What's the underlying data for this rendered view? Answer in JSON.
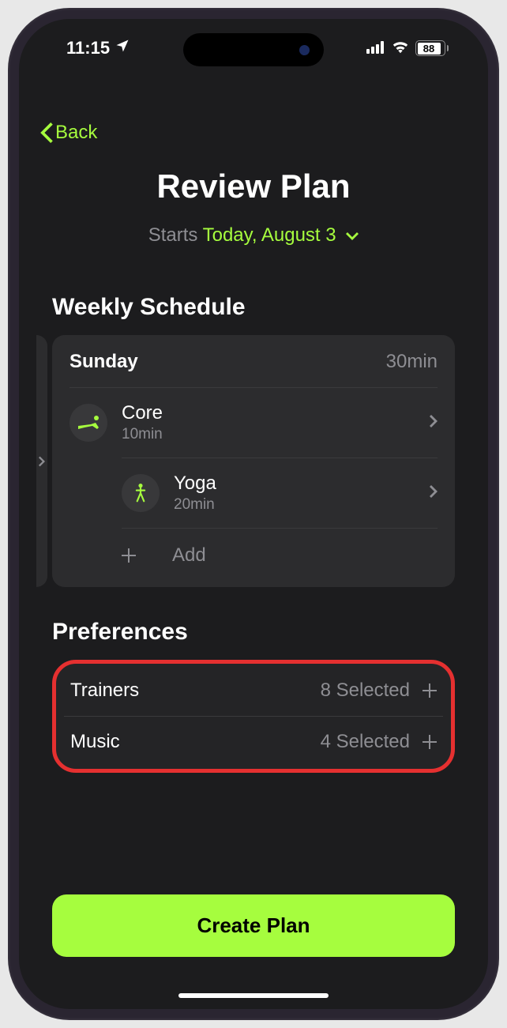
{
  "statusBar": {
    "time": "11:15",
    "battery": "88"
  },
  "nav": {
    "backLabel": "Back"
  },
  "header": {
    "title": "Review Plan",
    "startsPrefix": "Starts ",
    "startsDate": "Today, August 3"
  },
  "schedule": {
    "heading": "Weekly Schedule",
    "day": {
      "name": "Sunday",
      "totalDuration": "30min",
      "workouts": [
        {
          "name": "Core",
          "duration": "10min",
          "icon": "core"
        },
        {
          "name": "Yoga",
          "duration": "20min",
          "icon": "yoga"
        }
      ],
      "addLabel": "Add"
    }
  },
  "preferences": {
    "heading": "Preferences",
    "rows": [
      {
        "label": "Trainers",
        "value": "8 Selected"
      },
      {
        "label": "Music",
        "value": "4 Selected"
      }
    ]
  },
  "footer": {
    "createLabel": "Create Plan"
  }
}
